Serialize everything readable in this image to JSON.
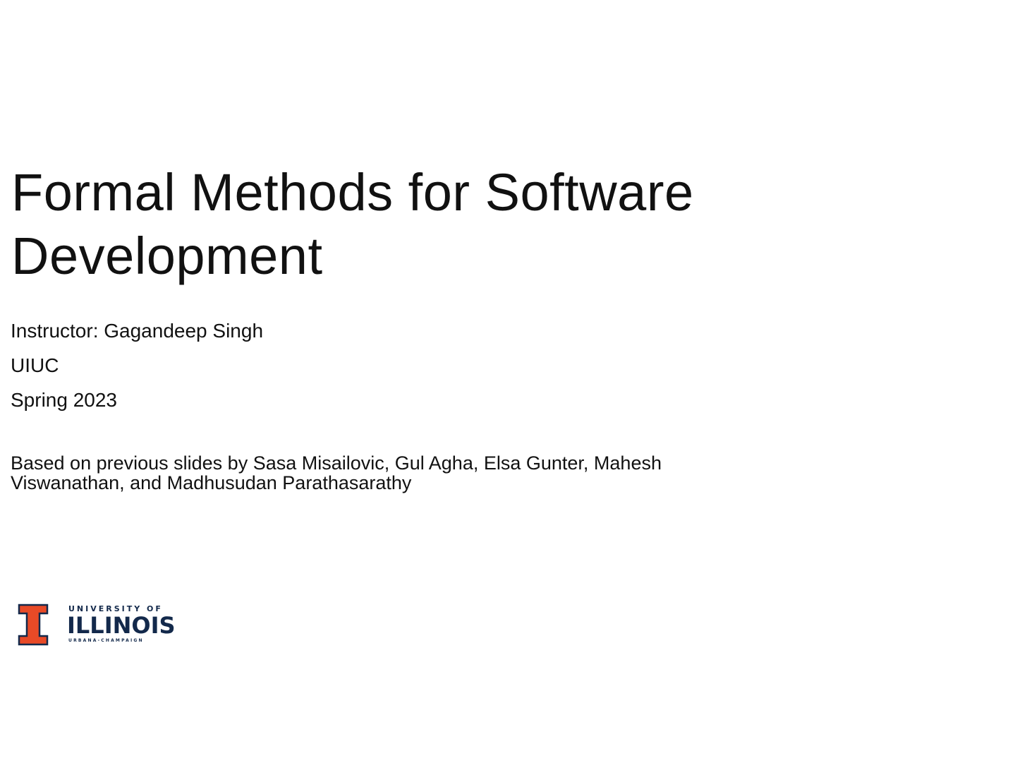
{
  "slide": {
    "title_lines": [
      "Formal Methods for Software",
      "Development"
    ],
    "subtitle_lines": [
      "Instructor: Gagandeep Singh",
      "UIUC",
      "Spring 2023"
    ],
    "credits_lines": [
      "Based on previous slides by Sasa Misailovic, Gul Agha, Elsa Gunter, Mahesh",
      "Viswanathan, and Madhusudan Parathasarathy"
    ],
    "logo": {
      "icon": "block-i-icon",
      "top_text": "UNIVERSITY OF",
      "main_text": "ILLINOIS",
      "bottom_text": "URBANA-CHAMPAIGN",
      "mark_color": "#e84a27",
      "mark_outline_color": "#13294b",
      "text_color": "#13294b"
    }
  }
}
